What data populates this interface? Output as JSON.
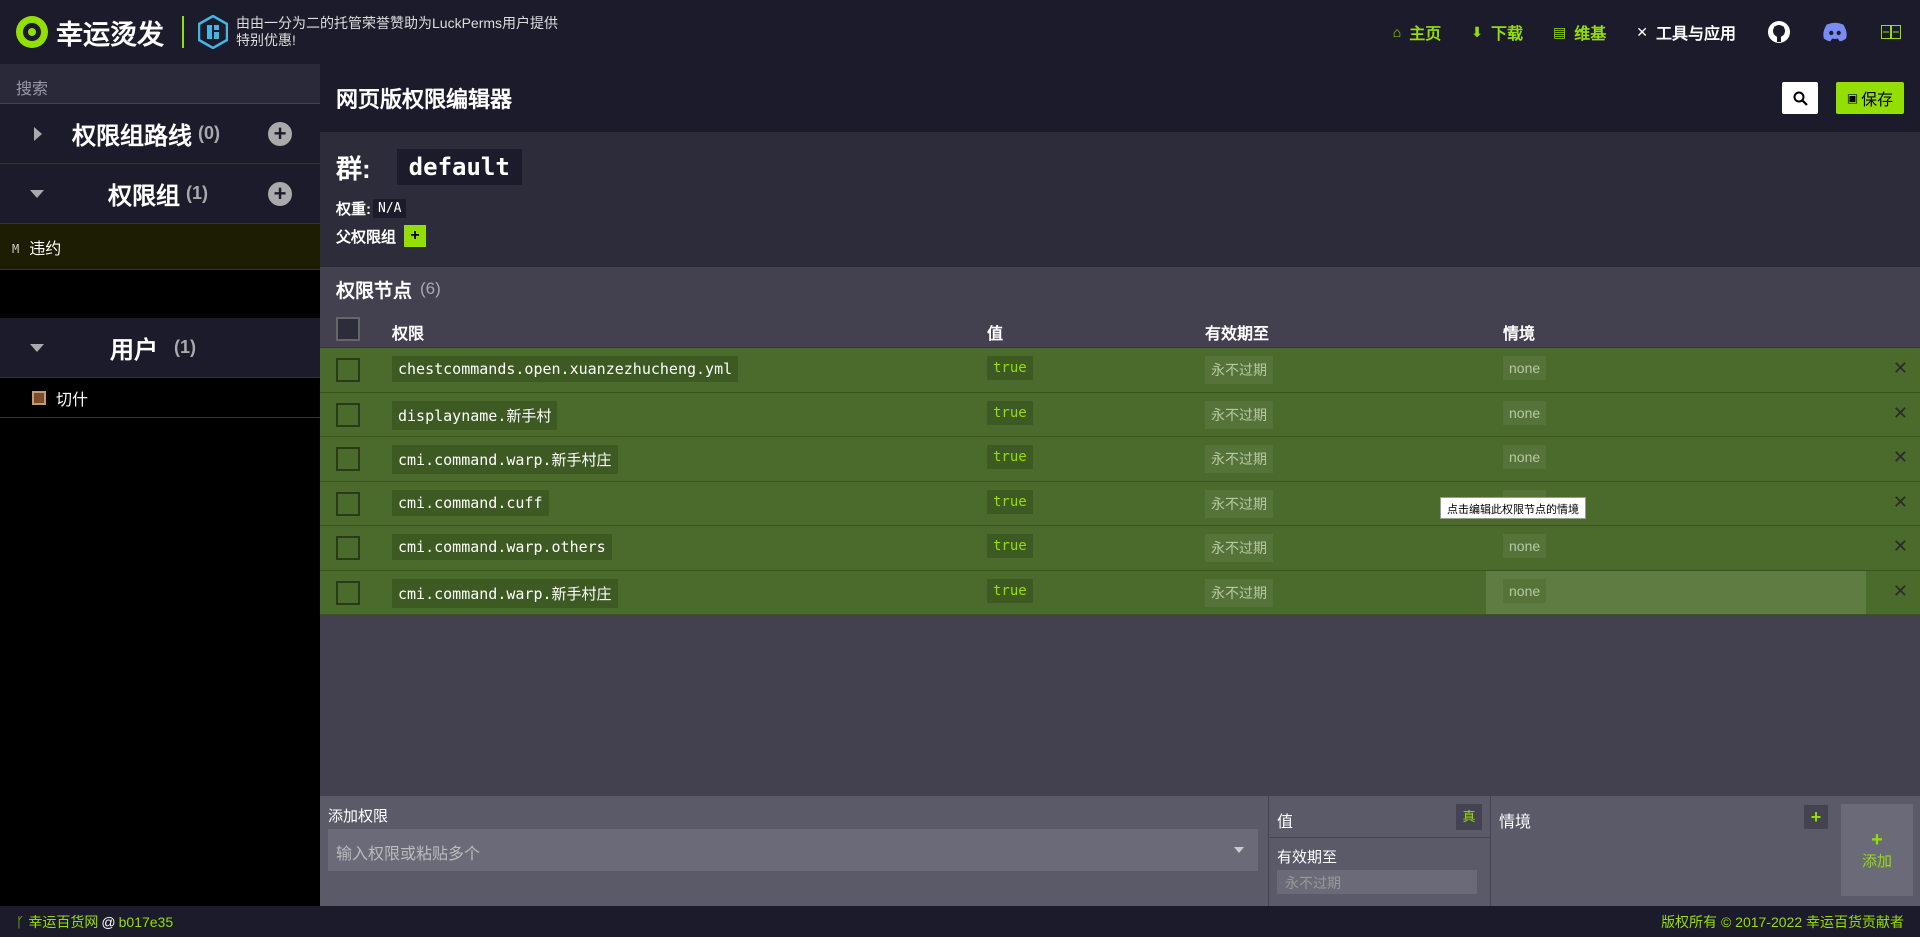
{
  "header": {
    "logo_text": "幸运烫发",
    "sponsor_text": "由由一分为二的托管荣誉赞助为LuckPerms用户提供特别优惠!",
    "nav": [
      {
        "label": "主页",
        "icon": "home-icon"
      },
      {
        "label": "下载",
        "icon": "download-icon"
      },
      {
        "label": "维基",
        "icon": "book-icon"
      },
      {
        "label": "工具与应用",
        "icon": "tools-icon"
      }
    ],
    "icons": [
      "github-icon",
      "discord-icon",
      "translate-icon"
    ]
  },
  "sidebar": {
    "search_placeholder": "搜索",
    "tracks": {
      "title": "权限组路线",
      "count": "(0)"
    },
    "groups": {
      "title": "权限组",
      "count": "(1)",
      "items": [
        {
          "tag": "M",
          "name": "违约"
        }
      ]
    },
    "users": {
      "title": "用户",
      "count": "(1)",
      "items": [
        {
          "name": "切什"
        }
      ]
    }
  },
  "editor": {
    "title": "网页版权限编辑器",
    "save_label": "保存",
    "group_label": "群:",
    "group_name": "default",
    "weight_label": "权重:",
    "weight_value": "N/A",
    "parent_label": "父权限组",
    "nodes_title": "权限节点",
    "nodes_count": "(6)",
    "columns": {
      "permission": "权限",
      "value": "值",
      "expiry": "有效期至",
      "context": "情境"
    },
    "rows": [
      {
        "permission": "chestcommands.open.xuanzezhucheng.yml",
        "value": "true",
        "expiry": "永不过期",
        "context": "none"
      },
      {
        "permission": "displayname.新手村",
        "value": "true",
        "expiry": "永不过期",
        "context": "none"
      },
      {
        "permission": "cmi.command.warp.新手村庄",
        "value": "true",
        "expiry": "永不过期",
        "context": "none"
      },
      {
        "permission": "cmi.command.cuff",
        "value": "true",
        "expiry": "永不过期",
        "context": "none"
      },
      {
        "permission": "cmi.command.warp.others",
        "value": "true",
        "expiry": "永不过期",
        "context": "none"
      },
      {
        "permission": "cmi.command.warp.新手村庄",
        "value": "true",
        "expiry": "永不过期",
        "context": "none"
      }
    ],
    "tooltip": "点击编辑此权限节点的情境"
  },
  "add": {
    "perm_label": "添加权限",
    "perm_placeholder": "输入权限或粘贴多个",
    "value_label": "值",
    "value_toggle": "真",
    "expiry_label": "有效期至",
    "expiry_placeholder": "永不过期",
    "context_label": "情境",
    "add_label": "添加"
  },
  "footer": {
    "left_site": "幸运百货网",
    "at": "@",
    "commit": "b017e35",
    "copyright": "版权所有 © 2017-2022 幸运百货贡献者"
  },
  "colors": {
    "accent": "#94df03",
    "header_bg": "#1c1b2b",
    "row_bg": "#4b6b2d"
  }
}
